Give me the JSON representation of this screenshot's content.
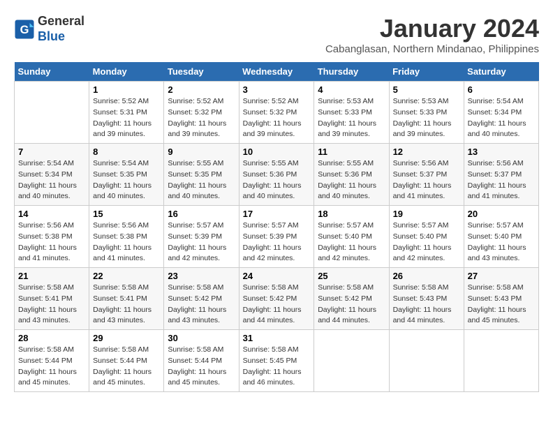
{
  "header": {
    "logo_line1": "General",
    "logo_line2": "Blue",
    "month_title": "January 2024",
    "location": "Cabanglasan, Northern Mindanao, Philippines"
  },
  "days_of_week": [
    "Sunday",
    "Monday",
    "Tuesday",
    "Wednesday",
    "Thursday",
    "Friday",
    "Saturday"
  ],
  "weeks": [
    [
      {
        "num": "",
        "info": ""
      },
      {
        "num": "1",
        "info": "Sunrise: 5:52 AM\nSunset: 5:31 PM\nDaylight: 11 hours\nand 39 minutes."
      },
      {
        "num": "2",
        "info": "Sunrise: 5:52 AM\nSunset: 5:32 PM\nDaylight: 11 hours\nand 39 minutes."
      },
      {
        "num": "3",
        "info": "Sunrise: 5:52 AM\nSunset: 5:32 PM\nDaylight: 11 hours\nand 39 minutes."
      },
      {
        "num": "4",
        "info": "Sunrise: 5:53 AM\nSunset: 5:33 PM\nDaylight: 11 hours\nand 39 minutes."
      },
      {
        "num": "5",
        "info": "Sunrise: 5:53 AM\nSunset: 5:33 PM\nDaylight: 11 hours\nand 39 minutes."
      },
      {
        "num": "6",
        "info": "Sunrise: 5:54 AM\nSunset: 5:34 PM\nDaylight: 11 hours\nand 40 minutes."
      }
    ],
    [
      {
        "num": "7",
        "info": "Sunrise: 5:54 AM\nSunset: 5:34 PM\nDaylight: 11 hours\nand 40 minutes."
      },
      {
        "num": "8",
        "info": "Sunrise: 5:54 AM\nSunset: 5:35 PM\nDaylight: 11 hours\nand 40 minutes."
      },
      {
        "num": "9",
        "info": "Sunrise: 5:55 AM\nSunset: 5:35 PM\nDaylight: 11 hours\nand 40 minutes."
      },
      {
        "num": "10",
        "info": "Sunrise: 5:55 AM\nSunset: 5:36 PM\nDaylight: 11 hours\nand 40 minutes."
      },
      {
        "num": "11",
        "info": "Sunrise: 5:55 AM\nSunset: 5:36 PM\nDaylight: 11 hours\nand 40 minutes."
      },
      {
        "num": "12",
        "info": "Sunrise: 5:56 AM\nSunset: 5:37 PM\nDaylight: 11 hours\nand 41 minutes."
      },
      {
        "num": "13",
        "info": "Sunrise: 5:56 AM\nSunset: 5:37 PM\nDaylight: 11 hours\nand 41 minutes."
      }
    ],
    [
      {
        "num": "14",
        "info": "Sunrise: 5:56 AM\nSunset: 5:38 PM\nDaylight: 11 hours\nand 41 minutes."
      },
      {
        "num": "15",
        "info": "Sunrise: 5:56 AM\nSunset: 5:38 PM\nDaylight: 11 hours\nand 41 minutes."
      },
      {
        "num": "16",
        "info": "Sunrise: 5:57 AM\nSunset: 5:39 PM\nDaylight: 11 hours\nand 42 minutes."
      },
      {
        "num": "17",
        "info": "Sunrise: 5:57 AM\nSunset: 5:39 PM\nDaylight: 11 hours\nand 42 minutes."
      },
      {
        "num": "18",
        "info": "Sunrise: 5:57 AM\nSunset: 5:40 PM\nDaylight: 11 hours\nand 42 minutes."
      },
      {
        "num": "19",
        "info": "Sunrise: 5:57 AM\nSunset: 5:40 PM\nDaylight: 11 hours\nand 42 minutes."
      },
      {
        "num": "20",
        "info": "Sunrise: 5:57 AM\nSunset: 5:40 PM\nDaylight: 11 hours\nand 43 minutes."
      }
    ],
    [
      {
        "num": "21",
        "info": "Sunrise: 5:58 AM\nSunset: 5:41 PM\nDaylight: 11 hours\nand 43 minutes."
      },
      {
        "num": "22",
        "info": "Sunrise: 5:58 AM\nSunset: 5:41 PM\nDaylight: 11 hours\nand 43 minutes."
      },
      {
        "num": "23",
        "info": "Sunrise: 5:58 AM\nSunset: 5:42 PM\nDaylight: 11 hours\nand 43 minutes."
      },
      {
        "num": "24",
        "info": "Sunrise: 5:58 AM\nSunset: 5:42 PM\nDaylight: 11 hours\nand 44 minutes."
      },
      {
        "num": "25",
        "info": "Sunrise: 5:58 AM\nSunset: 5:42 PM\nDaylight: 11 hours\nand 44 minutes."
      },
      {
        "num": "26",
        "info": "Sunrise: 5:58 AM\nSunset: 5:43 PM\nDaylight: 11 hours\nand 44 minutes."
      },
      {
        "num": "27",
        "info": "Sunrise: 5:58 AM\nSunset: 5:43 PM\nDaylight: 11 hours\nand 45 minutes."
      }
    ],
    [
      {
        "num": "28",
        "info": "Sunrise: 5:58 AM\nSunset: 5:44 PM\nDaylight: 11 hours\nand 45 minutes."
      },
      {
        "num": "29",
        "info": "Sunrise: 5:58 AM\nSunset: 5:44 PM\nDaylight: 11 hours\nand 45 minutes."
      },
      {
        "num": "30",
        "info": "Sunrise: 5:58 AM\nSunset: 5:44 PM\nDaylight: 11 hours\nand 45 minutes."
      },
      {
        "num": "31",
        "info": "Sunrise: 5:58 AM\nSunset: 5:45 PM\nDaylight: 11 hours\nand 46 minutes."
      },
      {
        "num": "",
        "info": ""
      },
      {
        "num": "",
        "info": ""
      },
      {
        "num": "",
        "info": ""
      }
    ]
  ]
}
